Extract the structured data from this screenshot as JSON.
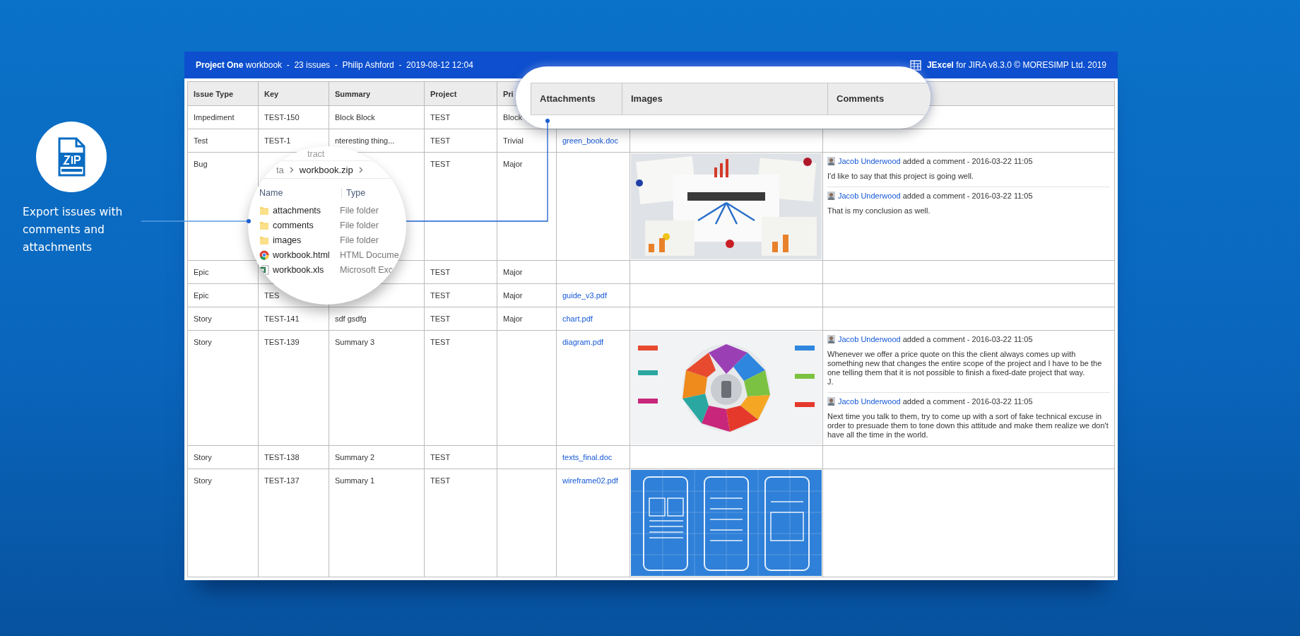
{
  "window": {
    "title": "**Project One** workbook  -  23 issues  -  Philip Ashford  -  2019-08-12 12:04",
    "app_credit": "**JExcel** for JIRA v8.3.0 © MORESIMP Ltd. 2019"
  },
  "feature": {
    "caption": "Export issues with comments and attachments"
  },
  "table": {
    "columns": [
      "Issue Type",
      "Key",
      "Summary",
      "Project",
      "Pri"
    ],
    "rows": [
      {
        "type": "Impediment",
        "key": "TEST-150",
        "summary": "Block Block",
        "project": "TEST",
        "priority": "Block"
      },
      {
        "type": "Test",
        "key": "TEST-1",
        "summary": "nteresting thing...",
        "project": "TEST",
        "priority": "Trivial",
        "attachment": "green_book.doc"
      },
      {
        "type": "Bug",
        "project": "TEST",
        "priority": "Major",
        "image": {
          "kind": "picture"
        },
        "comments": [
          {
            "author": "Jacob Underwood",
            "action": "added a comment - 2016-03-22 11:05",
            "text": "I'd like to say that this project is going well."
          },
          {
            "author": "Jacob Underwood",
            "action": "added a comment - 2016-03-22 11:05",
            "text": "That is my conclusion as well."
          }
        ]
      },
      {
        "type": "Epic",
        "project": "TEST",
        "priority": "Major"
      },
      {
        "type": "Epic",
        "key": "TES",
        "project": "TEST",
        "priority": "Major",
        "attachment": "guide_v3.pdf"
      },
      {
        "type": "Story",
        "key": "TEST-141",
        "summary": "sdf gsdfg",
        "project": "TEST",
        "priority": "Major",
        "attachment": "chart.pdf"
      },
      {
        "type": "Story",
        "key": "TEST-139",
        "summary": "Summary 3",
        "project": "TEST",
        "attachment": "diagram.pdf",
        "image": {
          "kind": "picture"
        },
        "comments": [
          {
            "author": "Jacob Underwood",
            "action": "added a comment - 2016-03-22 11:05",
            "text": "Whenever we offer a price quote on this the client always comes up with something new that changes the entire scope of the project and I have to be the one telling them that it is not possible to finish a fixed-date project that way.\nJ."
          },
          {
            "author": "Jacob Underwood",
            "action": "added a comment - 2016-03-22 11:05",
            "text": "Next time you talk to them, try to come up with a sort of fake technical excuse in order to presuade them to tone down this attitude and make them realize we don't have all the time in the world."
          }
        ]
      },
      {
        "type": "Story",
        "key": "TEST-138",
        "summary": "Summary 2",
        "project": "TEST",
        "attachment": "texts_final.doc"
      },
      {
        "type": "Story",
        "key": "TEST-137",
        "summary": "Summary 1",
        "project": "TEST",
        "attachment": "wireframe02.pdf",
        "image": {
          "kind": "picture"
        }
      }
    ]
  },
  "column_magnifier": {
    "columns": [
      "Attachments",
      "Images",
      "Comments"
    ]
  },
  "archive_magnifier": {
    "toolbar": "tract",
    "path": [
      "ta",
      "workbook.zip"
    ],
    "columns": [
      "Name",
      "Type"
    ],
    "files": [
      {
        "kind": "folder",
        "name": "attachments",
        "type": "File folder"
      },
      {
        "kind": "folder",
        "name": "comments",
        "type": "File folder"
      },
      {
        "kind": "folder",
        "name": "images",
        "type": "File folder"
      },
      {
        "kind": "html",
        "name": "workbook.html",
        "type": "HTML Docume"
      },
      {
        "kind": "spreadsheet",
        "name": "workbook.xls",
        "type": "Microsoft Exc"
      }
    ]
  }
}
